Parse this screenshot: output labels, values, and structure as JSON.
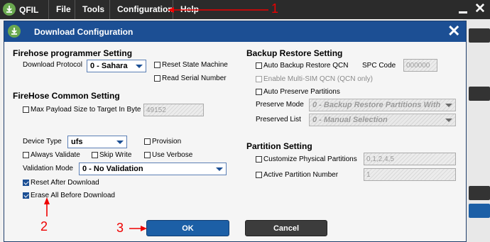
{
  "app": {
    "title": "QFIL",
    "menu": [
      "File",
      "Tools",
      "Configuration",
      "Help"
    ]
  },
  "dialog": {
    "title": "Download Configuration",
    "firehose_programmer": {
      "heading": "Firehose programmer Setting",
      "download_protocol_label": "Download Protocol",
      "download_protocol_value": "0 - Sahara",
      "reset_state_machine": {
        "label": "Reset State Machine",
        "checked": false
      },
      "read_serial_number": {
        "label": "Read Serial Number",
        "checked": false
      }
    },
    "firehose_common": {
      "heading": "FireHose Common Setting",
      "max_payload": {
        "label": "Max Payload Size to Target In Byte",
        "checked": false,
        "value": "49152"
      },
      "device_type_label": "Device Type",
      "device_type_value": "ufs",
      "provision": {
        "label": "Provision",
        "checked": false
      },
      "always_validate": {
        "label": "Always Validate",
        "checked": false
      },
      "skip_write": {
        "label": "Skip Write",
        "checked": false
      },
      "use_verbose": {
        "label": "Use Verbose",
        "checked": false
      },
      "validation_mode_label": "Validation Mode",
      "validation_mode_value": "0 - No Validation",
      "reset_after_download": {
        "label": "Reset After Download",
        "checked": true
      },
      "erase_all_before_download": {
        "label": "Erase All Before Download",
        "checked": true
      }
    },
    "backup_restore": {
      "heading": "Backup Restore Setting",
      "auto_backup_restore_qcn": {
        "label": "Auto Backup Restore QCN",
        "checked": false
      },
      "spc_code_label": "SPC Code",
      "spc_code_value": "000000",
      "enable_multi_sim_qcn": {
        "label": "Enable Multi-SIM QCN (QCN only)",
        "checked": false
      },
      "auto_preserve_partitions": {
        "label": "Auto Preserve Partitions",
        "checked": false
      },
      "preserve_mode_label": "Preserve Mode",
      "preserve_mode_value": "0 - Backup Restore Partitions With",
      "preserved_list_label": "Preserved List",
      "preserved_list_value": "0 - Manual Selection"
    },
    "partition": {
      "heading": "Partition Setting",
      "customize_physical_partitions": {
        "label": "Customize Physical Partitions",
        "checked": false,
        "value": "0,1,2,4,5"
      },
      "active_partition_number": {
        "label": "Active Partition Number",
        "checked": false,
        "value": "1"
      }
    },
    "buttons": {
      "ok": "OK",
      "cancel": "Cancel"
    }
  },
  "annotations": {
    "step1": "1",
    "step2": "2",
    "step3": "3"
  },
  "colors": {
    "title_bar": "#1c4f94",
    "annotation": "#e00000",
    "ok_button": "#1c5fa6",
    "cancel_button": "#3c3c3c"
  }
}
